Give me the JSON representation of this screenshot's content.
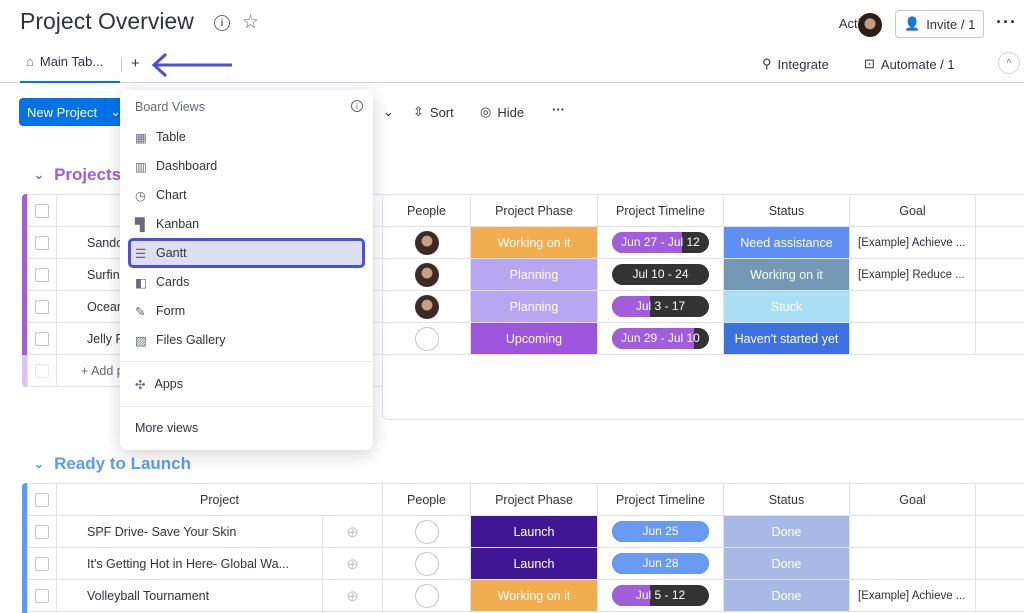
{
  "header": {
    "title": "Project Overview",
    "activity_label": "Activity",
    "invite_label": "Invite / 1",
    "more_icon": "more-horizontal-icon"
  },
  "tabs": {
    "main_tab": "Main Tab...",
    "add_tab": "+",
    "integrate": "Integrate",
    "automate": "Automate / 1"
  },
  "toolbar": {
    "new_project": "New Project",
    "sort": "Sort",
    "hide": "Hide",
    "more": "···"
  },
  "board_views_menu": {
    "title": "Board Views",
    "items": [
      {
        "label": "Table",
        "icon": "table-icon"
      },
      {
        "label": "Dashboard",
        "icon": "dashboard-icon"
      },
      {
        "label": "Chart",
        "icon": "chart-icon"
      },
      {
        "label": "Kanban",
        "icon": "kanban-icon"
      },
      {
        "label": "Gantt",
        "icon": "gantt-icon",
        "selected": true
      },
      {
        "label": "Cards",
        "icon": "cards-icon"
      },
      {
        "label": "Form",
        "icon": "form-icon"
      },
      {
        "label": "Files Gallery",
        "icon": "gallery-icon"
      }
    ],
    "apps": "Apps",
    "more_views": "More views"
  },
  "columns": [
    "Project",
    "People",
    "Project Phase",
    "Project Timeline",
    "Status",
    "Goal"
  ],
  "colors": {
    "accent": "#0073ea",
    "group1": "#a25ddc",
    "group2": "#579bfc",
    "timeline_progress": "#a25ddc",
    "timeline_done": "#6a9bf4",
    "timeline_rest": "#333333"
  },
  "groups": [
    {
      "title": "Projects",
      "color": "#a25ddc",
      "add_label": "+ Add p",
      "rows": [
        {
          "name": "Sando",
          "person": "photo",
          "phase": "Working on it",
          "phase_color": "#f2ad4f",
          "timeline": "Jun 27 - Jul 12",
          "timeline_progress": 0.72,
          "status": "Need assistance",
          "status_color": "#5f8ef5",
          "goal": "[Example] Achieve ..."
        },
        {
          "name": "Surfin",
          "person": "photo",
          "phase": "Planning",
          "phase_color": "#b7a6f2",
          "timeline": "Jul 10 - 24",
          "timeline_progress": 0,
          "status": "Working on it",
          "status_color": "#7398b3",
          "goal": "[Example] Reduce ..."
        },
        {
          "name": "Ocear",
          "person": "photo",
          "phase": "Planning",
          "phase_color": "#b7a6f2",
          "timeline": "Jul 3 - 17",
          "timeline_progress": 0.39,
          "status": "Stuck",
          "status_color": "#a9def3",
          "goal": ""
        },
        {
          "name": "Jelly F",
          "person": "empty",
          "phase": "Upcoming",
          "phase_color": "#9d55dc",
          "timeline": "Jun 29 - Jul 10",
          "timeline_progress": 0.85,
          "status": "Haven't started yet",
          "status_color": "#3d70e0",
          "goal": ""
        }
      ]
    },
    {
      "title": "Ready to Launch",
      "color": "#579bfc",
      "rows": [
        {
          "name": "SPF Drive- Save Your Skin",
          "person": "empty",
          "phase": "Launch",
          "phase_color": "#401694",
          "timeline": "Jun 25",
          "timeline_progress": 1,
          "status": "Done",
          "status_color": "#a8b9e6",
          "goal": ""
        },
        {
          "name": "It's Getting Hot in Here- Global Wa...",
          "person": "empty",
          "phase": "Launch",
          "phase_color": "#401694",
          "timeline": "Jun 28",
          "timeline_progress": 1,
          "status": "Done",
          "status_color": "#a8b9e6",
          "goal": ""
        },
        {
          "name": "Volleyball Tournament",
          "person": "empty",
          "phase": "Working on it",
          "phase_color": "#f2ad4f",
          "timeline": "Jul 5 - 12",
          "timeline_progress": 0.39,
          "status": "Done",
          "status_color": "#a8b9e6",
          "goal": "[Example] Achieve ..."
        }
      ]
    }
  ]
}
